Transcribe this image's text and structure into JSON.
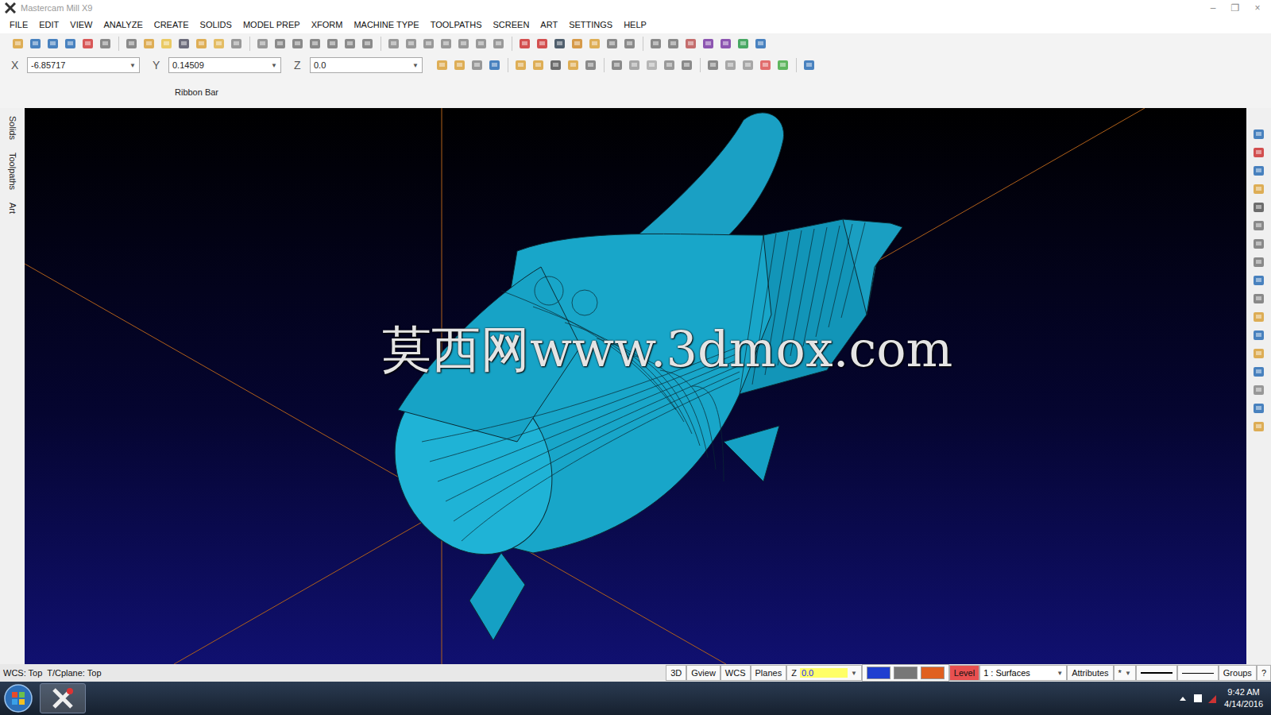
{
  "window": {
    "title": "Mastercam Mill X9",
    "controls": [
      "–",
      "❐",
      "×"
    ]
  },
  "menu": [
    "FILE",
    "EDIT",
    "VIEW",
    "ANALYZE",
    "CREATE",
    "SOLIDS",
    "MODEL PREP",
    "XFORM",
    "MACHINE TYPE",
    "TOOLPATHS",
    "SCREEN",
    "ART",
    "SETTINGS",
    "HELP"
  ],
  "coords": [
    {
      "label": "X",
      "value": "-6.85717"
    },
    {
      "label": "Y",
      "value": "0.14509"
    },
    {
      "label": "Z",
      "value": "0.0"
    }
  ],
  "ribbon": {
    "label": "Ribbon Bar"
  },
  "side_tabs": [
    {
      "label": "Solids",
      "selected": false
    },
    {
      "label": "Toolpaths",
      "selected": false
    },
    {
      "label": "Art",
      "selected": false
    }
  ],
  "viewport": {
    "watermark": "莫西网www.3dmox.com"
  },
  "status_bar": {
    "left": "WCS: Top  T/Cplane: Top",
    "buttons": [
      "3D",
      "Gview",
      "WCS",
      "Planes"
    ],
    "z_label": "Z",
    "z_value": "0.0",
    "level_label": "Level",
    "level_value": "1 : Surfaces",
    "attributes": "Attributes",
    "marker": "*",
    "groups": "Groups",
    "help": "?"
  },
  "taskbar": {
    "time": "9:42 AM",
    "date": "4/14/2016"
  }
}
